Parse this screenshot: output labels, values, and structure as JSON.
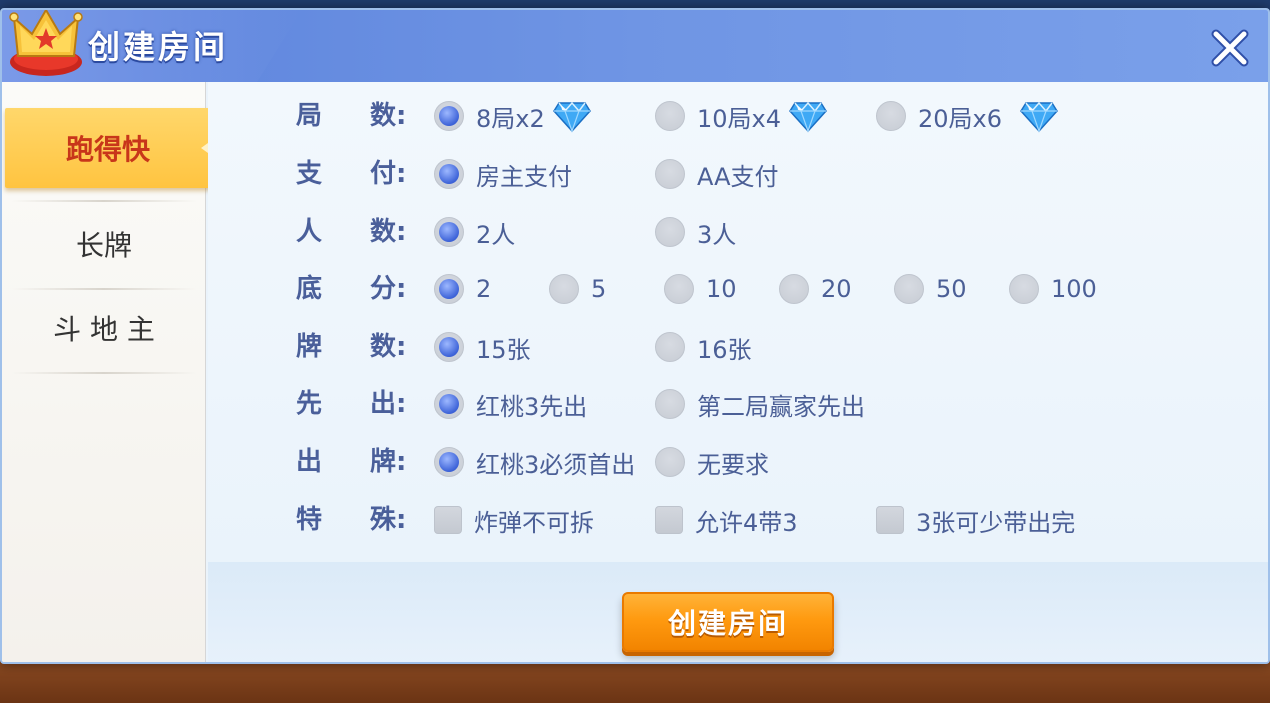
{
  "dialog": {
    "title": "创建房间",
    "close_icon": "close-icon"
  },
  "sidebar": {
    "items": [
      {
        "label": "跑得快",
        "active": true
      },
      {
        "label": "长牌",
        "active": false
      },
      {
        "label": "斗 地 主",
        "active": false
      }
    ]
  },
  "options": {
    "rounds": {
      "label1": "局",
      "label2": "数:",
      "choices": [
        {
          "text": "8局x2",
          "selected": true,
          "icon": "diamond-icon"
        },
        {
          "text": "10局x4",
          "selected": false,
          "icon": "diamond-icon"
        },
        {
          "text": "20局x6",
          "selected": false,
          "icon": "diamond-icon"
        }
      ]
    },
    "payment": {
      "label1": "支",
      "label2": "付:",
      "choices": [
        {
          "text": "房主支付",
          "selected": true
        },
        {
          "text": "AA支付",
          "selected": false
        }
      ]
    },
    "players": {
      "label1": "人",
      "label2": "数:",
      "choices": [
        {
          "text": "2人",
          "selected": true
        },
        {
          "text": "3人",
          "selected": false
        }
      ]
    },
    "base_score": {
      "label1": "底",
      "label2": "分:",
      "choices": [
        {
          "text": "2",
          "selected": true
        },
        {
          "text": "5",
          "selected": false
        },
        {
          "text": "10",
          "selected": false
        },
        {
          "text": "20",
          "selected": false
        },
        {
          "text": "50",
          "selected": false
        },
        {
          "text": "100",
          "selected": false
        }
      ]
    },
    "cards": {
      "label1": "牌",
      "label2": "数:",
      "choices": [
        {
          "text": "15张",
          "selected": true
        },
        {
          "text": "16张",
          "selected": false
        }
      ]
    },
    "first_play": {
      "label1": "先",
      "label2": "出:",
      "choices": [
        {
          "text": "红桃3先出",
          "selected": true
        },
        {
          "text": "第二局赢家先出",
          "selected": false
        }
      ]
    },
    "play_rule": {
      "label1": "出",
      "label2": "牌:",
      "choices": [
        {
          "text": "红桃3必须首出",
          "selected": true
        },
        {
          "text": "无要求",
          "selected": false
        }
      ]
    },
    "special": {
      "label1": "特",
      "label2": "殊:",
      "choices": [
        {
          "text": "炸弹不可拆",
          "checked": false
        },
        {
          "text": "允许4带3",
          "checked": false
        },
        {
          "text": "3张可少带出完",
          "checked": false
        }
      ]
    }
  },
  "create_button": {
    "label": "创建房间"
  },
  "colors": {
    "header": "#6f95e4",
    "accent_orange": "#ff9a10",
    "label_blue": "#4a5f9a",
    "radio_selected": "#3d63d8",
    "active_tab": "#ffc440"
  }
}
